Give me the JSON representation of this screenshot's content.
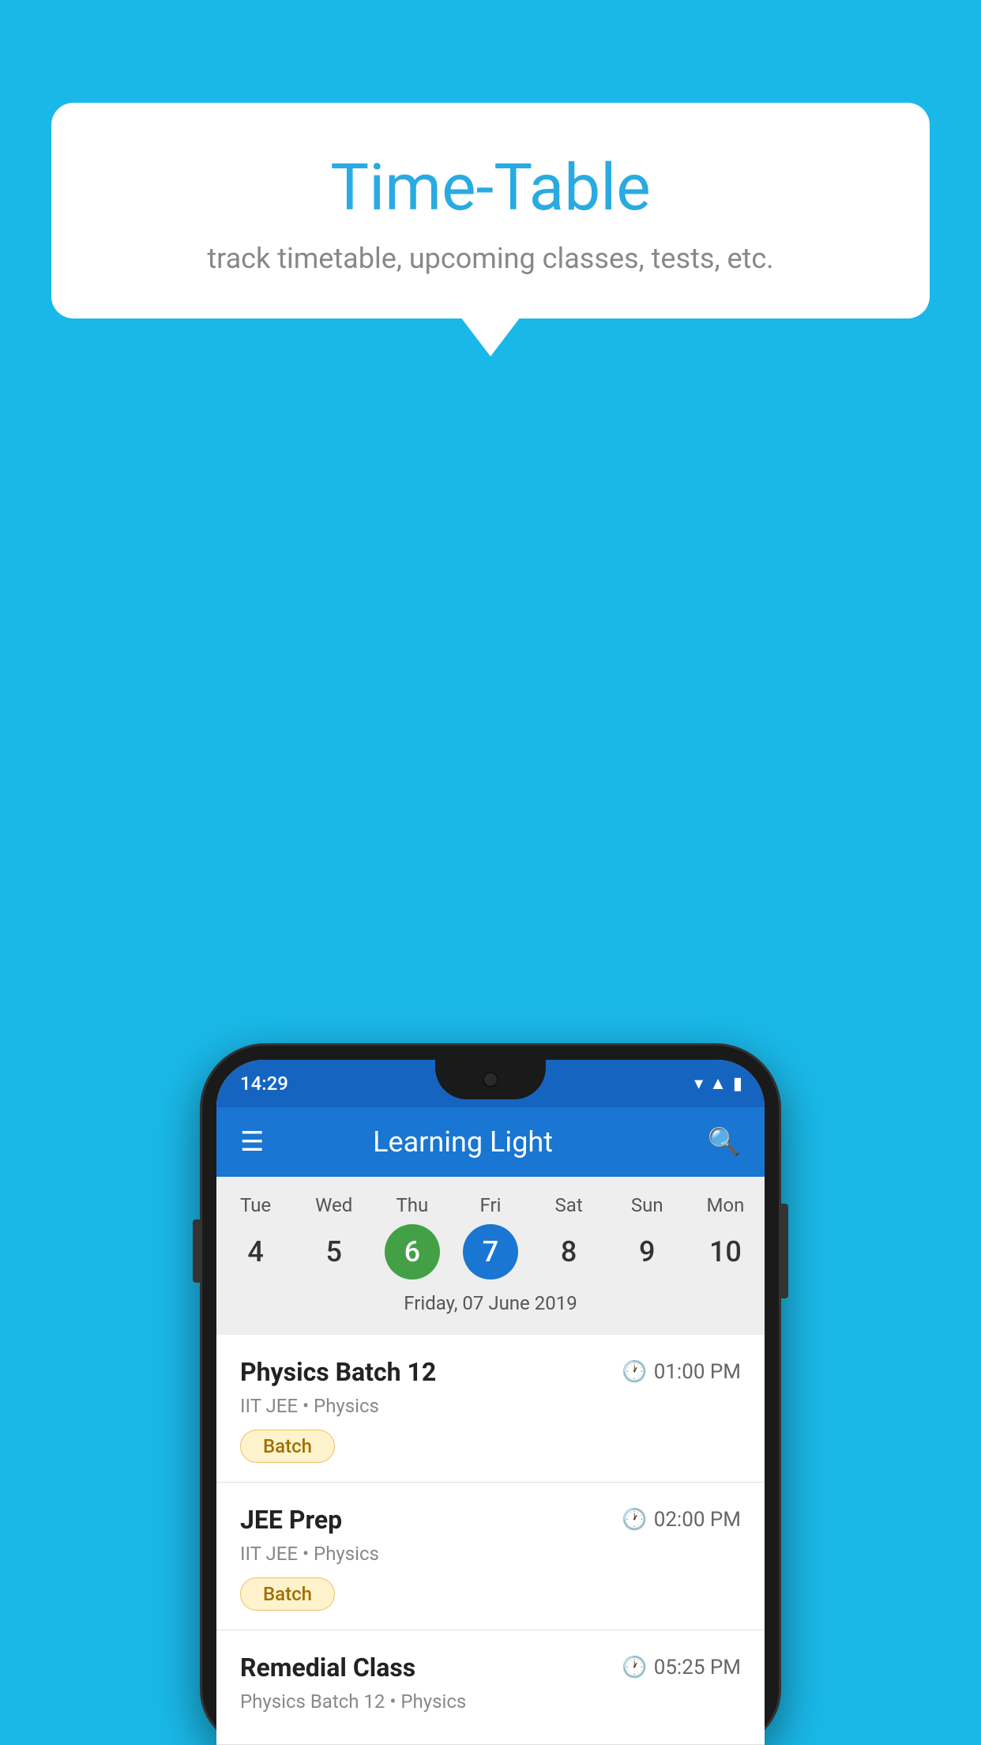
{
  "background_color": "#1ab8e8",
  "bubble": {
    "title": "Time-Table",
    "subtitle": "track timetable, upcoming classes, tests, etc."
  },
  "status_bar": {
    "time": "14:29"
  },
  "app_bar": {
    "title": "Learning Light",
    "hamburger_label": "☰",
    "search_label": "🔍"
  },
  "calendar": {
    "days": [
      {
        "abbr": "Tue",
        "num": "4"
      },
      {
        "abbr": "Wed",
        "num": "5"
      },
      {
        "abbr": "Thu",
        "num": "6",
        "state": "today"
      },
      {
        "abbr": "Fri",
        "num": "7",
        "state": "selected"
      },
      {
        "abbr": "Sat",
        "num": "8"
      },
      {
        "abbr": "Sun",
        "num": "9"
      },
      {
        "abbr": "Mon",
        "num": "10"
      }
    ],
    "selected_date_label": "Friday, 07 June 2019"
  },
  "classes": [
    {
      "name": "Physics Batch 12",
      "time": "01:00 PM",
      "subject": "IIT JEE • Physics",
      "badge": "Batch"
    },
    {
      "name": "JEE Prep",
      "time": "02:00 PM",
      "subject": "IIT JEE • Physics",
      "badge": "Batch"
    },
    {
      "name": "Remedial Class",
      "time": "05:25 PM",
      "subject": "Physics Batch 12 • Physics",
      "badge": null
    }
  ]
}
